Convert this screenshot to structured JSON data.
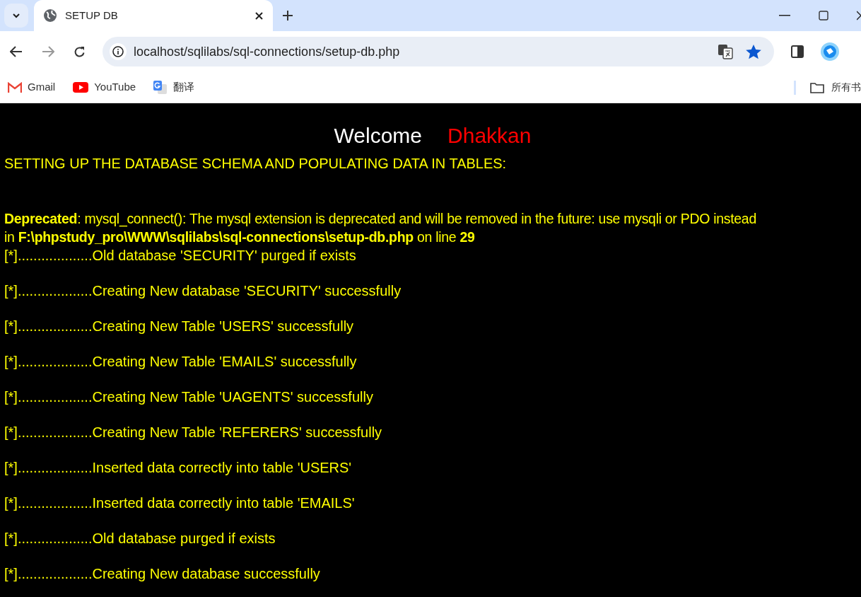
{
  "tabs": [
    {
      "title": "SETUP DB",
      "selected": true
    }
  ],
  "address_bar": {
    "url": "localhost/sqlilabs/sql-connections/setup-db.php"
  },
  "bookmarks": [
    {
      "label": "Gmail",
      "kind": "gmail"
    },
    {
      "label": "YouTube",
      "kind": "youtube"
    },
    {
      "label": "翻译",
      "kind": "translate"
    }
  ],
  "bookmarks_folder": "所有书",
  "page": {
    "welcome": "Welcome",
    "name": "Dhakkan",
    "heading": "SETTING UP THE DATABASE SCHEMA AND POPULATING DATA IN TABLES:",
    "warning": [
      "**Deprecated**: mysql_connect(): The mysql extension is deprecated and will be removed in the future: use mysqli or PDO instead",
      "in **F:\\phpstudy_pro\\WWW\\sqlilabs\\sql-connections\\setup-db.php** on line **29**"
    ],
    "log": [
      "[*]...................Old database 'SECURITY' purged if exists",
      "[*]...................Creating New database 'SECURITY' successfully",
      "[*]...................Creating New Table 'USERS' successfully",
      "[*]...................Creating New Table 'EMAILS' successfully",
      "[*]...................Creating New Table 'UAGENTS' successfully",
      "[*]...................Creating New Table 'REFERERS' successfully",
      "[*]...................Inserted data correctly into table 'USERS'",
      "[*]...................Inserted data correctly into table 'EMAILS'",
      "[*]...................Old database purged if exists",
      "[*]...................Creating New database successfully"
    ]
  }
}
